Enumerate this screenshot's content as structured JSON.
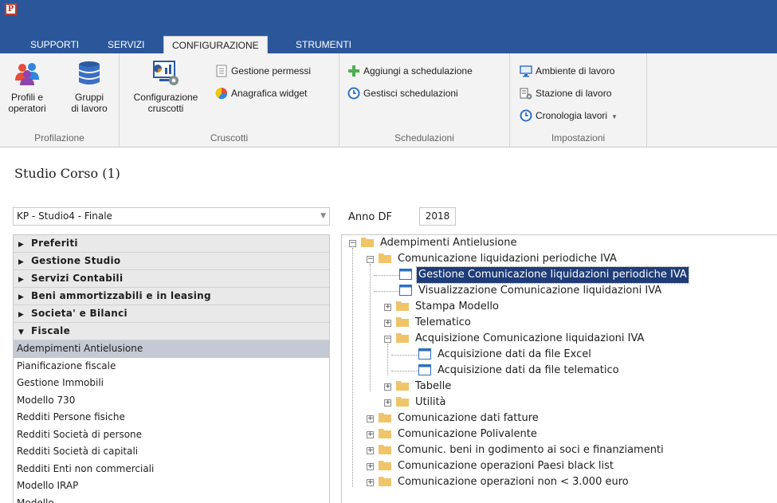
{
  "app": {
    "icon_letter": "P"
  },
  "tabs": [
    "SUPPORTI",
    "SERVIZI",
    "CONFIGURAZIONE",
    "STRUMENTI"
  ],
  "active_tab": "CONFIGURAZIONE",
  "ribbon": {
    "profilazione": {
      "label": "Profilazione",
      "profili_line1": "Profili e",
      "profili_line2": "operatori",
      "gruppi_line1": "Gruppi",
      "gruppi_line2": "di lavoro"
    },
    "cruscotti": {
      "label": "Cruscotti",
      "config_line1": "Configurazione",
      "config_line2": "cruscotti",
      "gestione_permessi": "Gestione permessi",
      "anagrafica_widget": "Anagrafica widget"
    },
    "schedulazioni": {
      "label": "Schedulazioni",
      "aggiungi": "Aggiungi a schedulazione",
      "gestisci": "Gestisci schedulazioni"
    },
    "impostazioni": {
      "label": "Impostazioni",
      "ambiente": "Ambiente di lavoro",
      "stazione": "Stazione di lavoro",
      "cronologia": "Cronologia lavori"
    }
  },
  "studio": {
    "title": "Studio Corso (1)",
    "select_value": "KP - Studio4 - Finale",
    "anno_label": "Anno DF",
    "anno_value": "2018"
  },
  "leftnav": {
    "categories": [
      "Preferiti",
      "Gestione Studio",
      "Servizi Contabili",
      "Beni ammortizzabili e in leasing",
      "Societa' e Bilanci",
      "Fiscale"
    ],
    "items": [
      "Adempimenti Antielusione",
      "Pianificazione fiscale",
      "Gestione Immobili",
      "Modello 730",
      "Redditi Persone fisiche",
      "Redditi Società di persone",
      "Redditi Società di capitali",
      "Redditi Enti non commerciali",
      "Modello IRAP",
      "Modello ..."
    ],
    "selected_item": "Adempimenti Antielusione"
  },
  "tree": {
    "root": "Adempimenti Antielusione",
    "comunicazione_liq": "Comunicazione liquidazioni periodiche IVA",
    "gestione_com": "Gestione Comunicazione liquidazioni periodiche IVA",
    "visualizzazione": "Visualizzazione Comunicazione liquidazioni IVA",
    "stampa": "Stampa Modello",
    "telematico": "Telematico",
    "acquisizione": "Acquisizione Comunicazione liquidazioni IVA",
    "acq_excel": "Acquisizione dati da file Excel",
    "acq_telematico": "Acquisizione dati da file telematico",
    "tabelle": "Tabelle",
    "utilita": "Utilità",
    "dati_fatture": "Comunicazione dati fatture",
    "polivalente": "Comunicazione Polivalente",
    "beni_godimento": "Comunic. beni in godimento ai soci e finanziamenti",
    "black_list": "Comunicazione operazioni Paesi black list",
    "operazioni_3000": "Comunicazione operazioni non < 3.000 euro"
  },
  "colors": {
    "titlebar": "#2b579a",
    "ribbon_bg": "#f3f3f3",
    "selection": "#1e3c78",
    "folder": "#f0c468"
  }
}
